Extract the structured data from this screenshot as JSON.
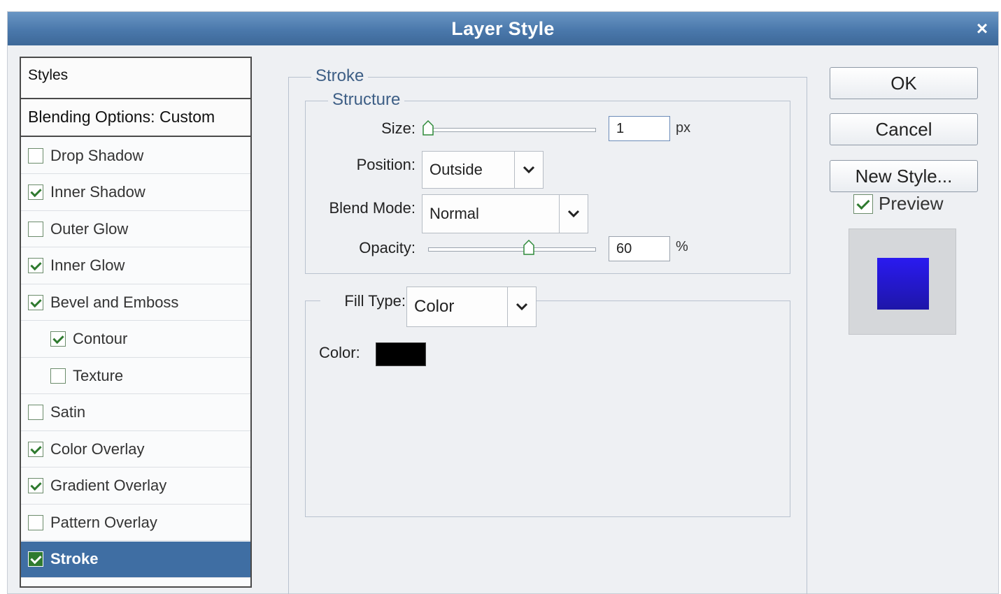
{
  "window": {
    "title": "Layer Style",
    "close_glyph": "×"
  },
  "styles_panel": {
    "header": "Styles",
    "blending_options": "Blending Options: Custom",
    "items": [
      {
        "label": "Drop Shadow",
        "checked": false,
        "indent": false
      },
      {
        "label": "Inner Shadow",
        "checked": true,
        "indent": false
      },
      {
        "label": "Outer Glow",
        "checked": false,
        "indent": false
      },
      {
        "label": "Inner Glow",
        "checked": true,
        "indent": false
      },
      {
        "label": "Bevel and Emboss",
        "checked": true,
        "indent": false
      },
      {
        "label": "Contour",
        "checked": true,
        "indent": true
      },
      {
        "label": "Texture",
        "checked": false,
        "indent": true
      },
      {
        "label": "Satin",
        "checked": false,
        "indent": false
      },
      {
        "label": "Color Overlay",
        "checked": true,
        "indent": false
      },
      {
        "label": "Gradient Overlay",
        "checked": true,
        "indent": false
      },
      {
        "label": "Pattern Overlay",
        "checked": false,
        "indent": false
      },
      {
        "label": "Stroke",
        "checked": true,
        "indent": false,
        "selected": true
      }
    ]
  },
  "stroke": {
    "group_title": "Stroke",
    "structure": {
      "title": "Structure",
      "size_label": "Size:",
      "size_value": "1",
      "size_unit": "px",
      "size_slider_fraction": 0.0,
      "position_label": "Position:",
      "position_value": "Outside",
      "blend_mode_label": "Blend Mode:",
      "blend_mode_value": "Normal",
      "opacity_label": "Opacity:",
      "opacity_value": "60",
      "opacity_unit": "%",
      "opacity_slider_fraction": 0.6
    },
    "fill": {
      "fill_type_label": "Fill Type:",
      "fill_type_value": "Color",
      "color_label": "Color:",
      "color_value": "#000000"
    }
  },
  "buttons": {
    "ok": "OK",
    "cancel": "Cancel",
    "new_style": "New Style..."
  },
  "preview": {
    "label": "Preview",
    "checked": true
  },
  "colors": {
    "title_bar": "#4a78ab",
    "selected_row": "#3f6ea3",
    "checkmark": "#2f7a2f",
    "preview_fill": "#2a1af0"
  },
  "icons": {
    "dropdown": "chevron-down-icon",
    "close": "close-icon",
    "slider": "slider-thumb-icon"
  }
}
